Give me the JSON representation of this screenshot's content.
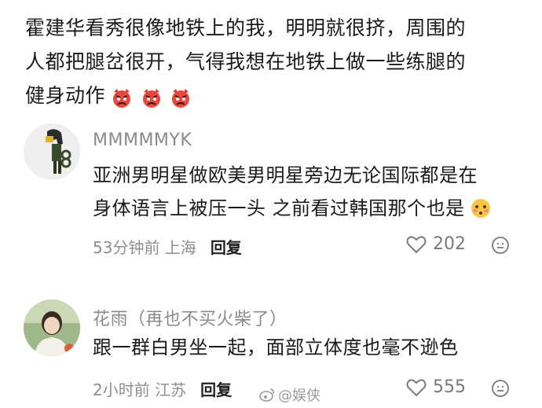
{
  "post": {
    "line1": "霍建华看秀很像地铁上的我，明明就很挤，周围的",
    "line2": "人都把腿岔很开，气得我想在地铁上做一些练腿的",
    "line3": "健身动作"
  },
  "comments": [
    {
      "username": "MMMMMYK",
      "line1": "亚洲男明星做欧美男明星旁边无论国际都是在",
      "line2": "身体语言上被压一头 之前看过韩国那个也是",
      "time_location": "53分钟前 上海",
      "reply_label": "回复",
      "likes": "202"
    },
    {
      "username": "花雨（再也不买火柴了）",
      "line1": "跟一群白男坐一起，面部立体度也毫不逊色",
      "time_location": "2小时前 江苏",
      "reply_label": "回复",
      "likes": "555"
    }
  ],
  "watermark": "@娱侠",
  "colors": {
    "emoji_red": "#e8483c",
    "meta_gray": "#8e8e8e"
  },
  "icons": [
    "angry-face-emoji",
    "like-heart-icon",
    "dislike-face-icon",
    "weibo-logo-icon"
  ]
}
